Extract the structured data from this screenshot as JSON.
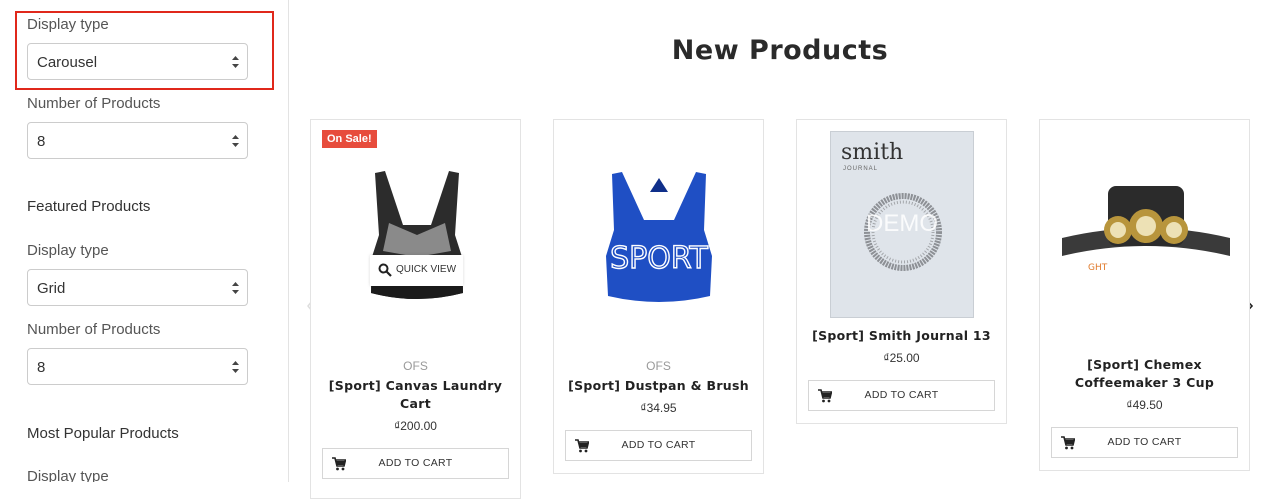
{
  "sidebar": {
    "new_products": {
      "display_type_label": "Display type",
      "display_type_value": "Carousel",
      "count_label": "Number of Products",
      "count_value": "8"
    },
    "featured": {
      "heading": "Featured Products",
      "display_type_label": "Display type",
      "display_type_value": "Grid",
      "count_label": "Number of Products",
      "count_value": "8"
    },
    "popular": {
      "heading": "Most Popular Products",
      "display_type_label": "Display type"
    }
  },
  "main": {
    "title": "New Products",
    "quick_view": "QUICK VIEW",
    "sale_badge": "On Sale!",
    "products": [
      {
        "vendor": "OFS",
        "name": "[Sport] Canvas Laundry Cart",
        "price": "₫200.00",
        "cart": "ADD TO CART"
      },
      {
        "vendor": "OFS",
        "name": "[Sport] Dustpan & Brush",
        "price": "₫34.95",
        "cart": "ADD TO CART"
      },
      {
        "name": "[Sport] Smith Journal 13",
        "price": "₫25.00",
        "cart": "ADD TO CART",
        "journal_brand": "smith",
        "journal_sub": "JOURNAL",
        "demo": "DEMO"
      },
      {
        "name": "[Sport] Chemex Coffeemaker 3 Cup",
        "price": "₫49.50",
        "cart": "ADD TO CART",
        "headlamp_text": "GHT"
      }
    ],
    "sport_text": "SPORT"
  },
  "colors": {
    "highlight": "#e0281b",
    "sale": "#e74c3c",
    "bra_blue": "#1f4fc4"
  }
}
